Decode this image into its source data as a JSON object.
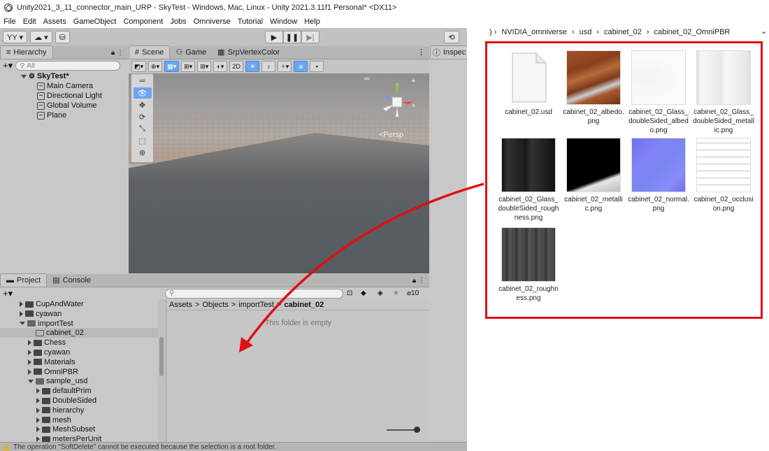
{
  "window": {
    "title": "Unity2021_3_11_connector_main_URP - SkyTest - Windows, Mac, Linux - Unity 2021.3.11f1 Personal* <DX11>"
  },
  "menu": [
    "File",
    "Edit",
    "Assets",
    "GameObject",
    "Component",
    "Jobs",
    "Omniverse",
    "Tutorial",
    "Window",
    "Help"
  ],
  "toolbar": {
    "account_label": "YY ▾",
    "cloud_label": "☁ ▾",
    "collab_label": "⛁"
  },
  "hierarchy": {
    "tab": "Hierarchy",
    "search_placeholder": "All",
    "scene_name": "SkyTest*",
    "objects": [
      "Main Camera",
      "Directional Light",
      "Global Volume",
      "Plane"
    ]
  },
  "scene": {
    "tabs": [
      "Scene",
      "Game",
      "SrpVertexColor"
    ],
    "toolbar_2d": "2D",
    "persp_label": "<Persp"
  },
  "inspector": {
    "tab": "Inspec"
  },
  "project": {
    "tabs": [
      "Project",
      "Console"
    ],
    "visible_count": "10",
    "tree": [
      {
        "label": "CupAndWater",
        "indent": 1,
        "expanded": false
      },
      {
        "label": "cyawan",
        "indent": 1,
        "expanded": false
      },
      {
        "label": "importTest",
        "indent": 1,
        "expanded": true
      },
      {
        "label": "cabinet_02",
        "indent": 2,
        "expanded": false,
        "selected": true,
        "empty": true
      },
      {
        "label": "Chess",
        "indent": 2,
        "expanded": false
      },
      {
        "label": "cyawan",
        "indent": 2,
        "expanded": false
      },
      {
        "label": "Materials",
        "indent": 2,
        "expanded": false
      },
      {
        "label": "OmniPBR",
        "indent": 2,
        "expanded": false
      },
      {
        "label": "sample_usd",
        "indent": 2,
        "expanded": true
      },
      {
        "label": "defaultPrim",
        "indent": 3,
        "expanded": false
      },
      {
        "label": "DoubleSided",
        "indent": 3,
        "expanded": false
      },
      {
        "label": "hierarchy",
        "indent": 3,
        "expanded": false
      },
      {
        "label": "mesh",
        "indent": 3,
        "expanded": false
      },
      {
        "label": "MeshSubset",
        "indent": 3,
        "expanded": false
      },
      {
        "label": "metersPerUnit",
        "indent": 3,
        "expanded": false
      }
    ],
    "breadcrumb": [
      "Assets",
      "Objects",
      "importTest",
      "cabinet_02"
    ],
    "empty_message": "This folder is empty"
  },
  "status": {
    "message": "The operation \"SoftDelete\" cannot be executed because the selection is a root folder."
  },
  "explorer": {
    "path": [
      "NVIDIA_omniverse",
      "usd",
      "cabinet_02",
      "cabinet_02_OmniPBR"
    ],
    "files": [
      {
        "name": "cabinet_02.usd",
        "thumb": "document"
      },
      {
        "name": "cabinet_02_albedo.png",
        "thumb": "wood"
      },
      {
        "name": "cabinet_02_Glass_doubleSided_albedo.png",
        "thumb": "white"
      },
      {
        "name": "cabinet_02_Glass_doubleSided_metallic.png",
        "thumb": "whitegrey"
      },
      {
        "name": "cabinet_02_Glass_doubleSided_roughness.png",
        "thumb": "dark"
      },
      {
        "name": "cabinet_02_metallic.png",
        "thumb": "black"
      },
      {
        "name": "cabinet_02_normal.png",
        "thumb": "normal"
      },
      {
        "name": "cabinet_02_occlusion.png",
        "thumb": "occlusion"
      },
      {
        "name": "cabinet_02_roughness.png",
        "thumb": "rough"
      }
    ]
  },
  "colors": {
    "annotation_red": "#e01010",
    "unity_panel": "#c8c8c8",
    "selection_blue": "#6aa6ef"
  }
}
